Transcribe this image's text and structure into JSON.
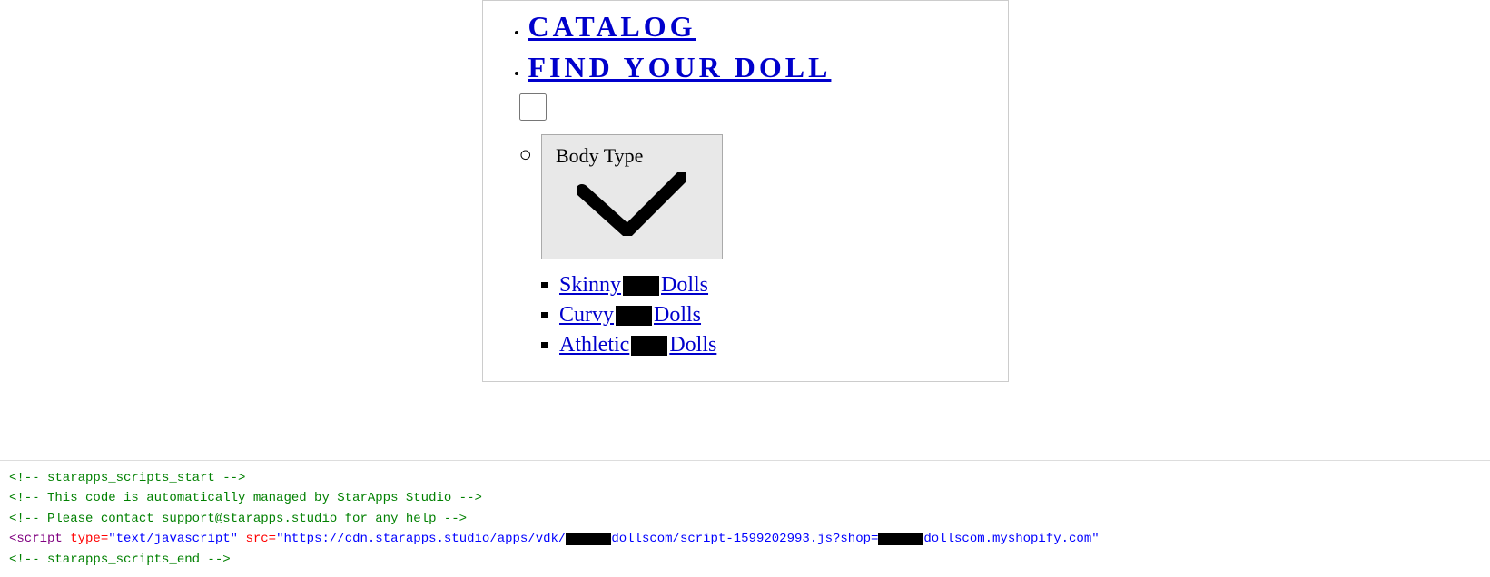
{
  "nav": {
    "catalog_label": "CATALOG",
    "find_doll_label": "FIND YOUR DOLL",
    "catalog_href": "#",
    "find_doll_href": "#"
  },
  "body_type": {
    "label": "Body Type",
    "dropdown_options": [
      "Body Type",
      "Skinny",
      "Curvy",
      "Athletic"
    ]
  },
  "sub_items": [
    {
      "prefix": "Skinny",
      "suffix": "Dolls",
      "href": "#"
    },
    {
      "prefix": "Curvy",
      "suffix": "Dolls",
      "href": "#"
    },
    {
      "prefix": "Athletic",
      "suffix": "Dolls",
      "href": "#"
    }
  ],
  "code": {
    "line1": "<!-- starapps_scripts_start -->",
    "line2": "<!-- This code is automatically managed by StarApps Studio -->",
    "line3": "<!-- Please contact support@starapps.studio for any help -->",
    "line4_before": "<script type=\"text/javascript\" src=\"https://cdn.starapps.studio/apps/vdk/",
    "line4_mid": "dollscom/script-1599202993.js?shop=",
    "line4_end": "dollscom.myshopify.com\"",
    "line5": "<!-- starapps_scripts_end -->"
  }
}
